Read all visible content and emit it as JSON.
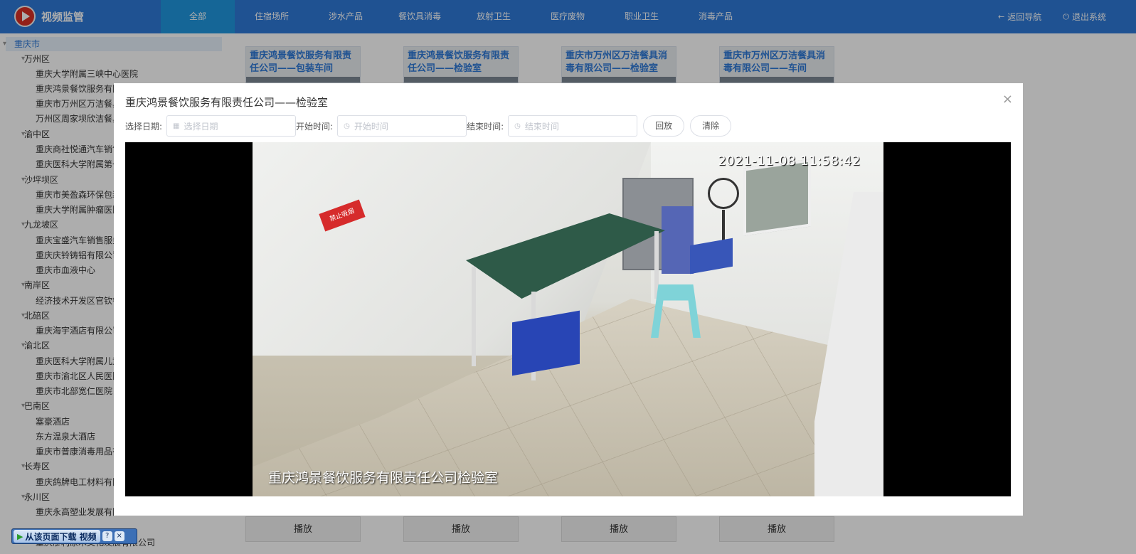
{
  "header": {
    "brand": "视频监管",
    "nav": [
      "全部",
      "住宿场所",
      "涉水产品",
      "餐饮具消毒",
      "放射卫生",
      "医疗废物",
      "职业卫生",
      "消毒产品"
    ],
    "back_label": "返回导航",
    "logout_label": "退出系统"
  },
  "sidebar": {
    "root": "重庆市",
    "districts": [
      "万州区",
      "渝中区",
      "沙坪坝区",
      "九龙坡区",
      "南岸区",
      "北碚区",
      "渝北区",
      "巴南区",
      "长寿区",
      "永川区"
    ],
    "leaves": [
      "重庆大学附属三峡中心医院",
      "重庆鸿景餐饮服务有限",
      "重庆市万州区万洁餐具",
      "万州区周家坝欣洁餐具",
      "重庆商社悦通汽车销售",
      "重庆医科大学附属第一",
      "重庆市美盈森环保包装",
      "重庆大学附属肿瘤医院",
      "重庆宝盛汽车销售服务",
      "重庆庆铃铸铝有限公司",
      "重庆市血液中心",
      "经济技术开发区官钦餐",
      "重庆海宇酒店有限公司",
      "重庆医科大学附属儿童",
      "重庆市渝北区人民医院",
      "重庆市北部宽仁医院",
      "塞豪酒店",
      "东方温泉大酒店",
      "重庆市普康消毒用品有",
      "重庆鸽牌电工材料有限",
      "重庆永高塑业发展有限公司",
      "重庆廖利原木文化发展有限公司"
    ]
  },
  "cards": [
    {
      "title": "重庆鸿景餐饮服务有限责任公司——包装车间",
      "play": "播放"
    },
    {
      "title": "重庆鸿景餐饮服务有限责任公司——检验室",
      "play": "播放"
    },
    {
      "title": "重庆市万州区万洁餐具消毒有限公司——检验室",
      "play": "播放"
    },
    {
      "title": "重庆市万州区万洁餐具消毒有限公司——车间",
      "play": "播放"
    }
  ],
  "modal": {
    "title": "重庆鸿景餐饮服务有限责任公司——检验室",
    "close": "×",
    "date_label": "选择日期:",
    "date_placeholder": "选择日期",
    "start_label": "开始时间:",
    "start_placeholder": "开始时间",
    "end_label": "结束时间:",
    "end_placeholder": "结束时间",
    "replay_label": "回放",
    "clear_label": "清除",
    "video": {
      "timestamp": "2021-11-08 11:58:42",
      "caption": "重庆鸿景餐饮服务有限责任公司检验室",
      "sign_text": "禁止吸烟"
    }
  },
  "download_widget": {
    "label": "从该页面下载 视频",
    "help": "?",
    "close": "×"
  },
  "colors": {
    "header_bg": "#2f7ad7",
    "nav_active": "#1f97df",
    "link_blue": "#2f7ad7"
  }
}
